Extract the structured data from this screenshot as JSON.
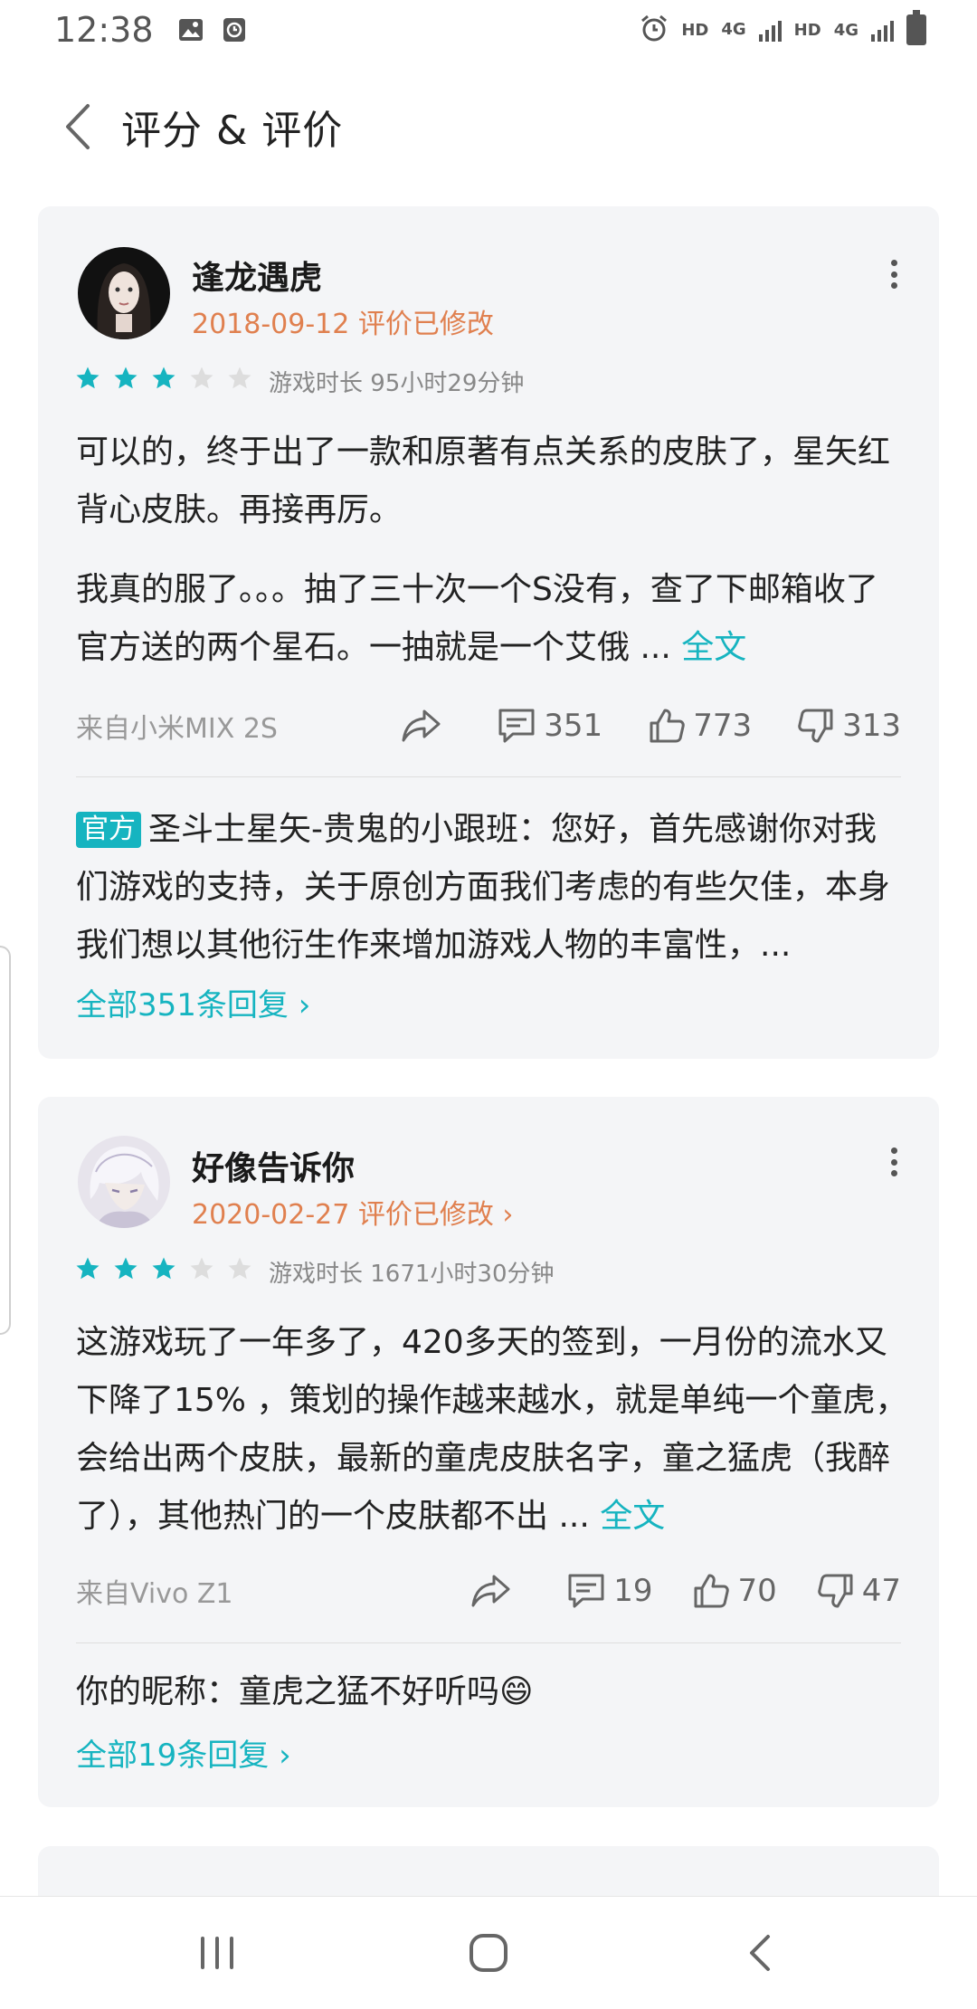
{
  "status_bar": {
    "time": "12:38",
    "indicators": [
      "HD",
      "4G",
      "HD",
      "4G"
    ],
    "icons": [
      "image-icon",
      "clock-app-icon",
      "alarm-icon",
      "signal-icon",
      "battery-icon"
    ]
  },
  "header": {
    "title": "评分 & 评价",
    "back_icon": "chevron-left-icon"
  },
  "reviews": [
    {
      "username": "逢龙遇虎",
      "date": "2018-09-12 评价已修改",
      "rating": 3,
      "max_rating": 5,
      "playtime": "游戏时长 95小时29分钟",
      "paragraphs": [
        "可以的，终于出了一款和原著有点关系的皮肤了，星矢红背心皮肤。再接再厉。",
        "我真的服了。。。抽了三十次一个S没有，查了下邮箱收了官方送的两个星石。一抽就是一个艾俄 ..."
      ],
      "full_text_label": "全文",
      "device": "来自小米MIX 2S",
      "comments": "351",
      "likes": "773",
      "dislikes": "313",
      "reply": {
        "badge": "官方",
        "text": "圣斗士星矢-贵鬼的小跟班：您好，首先感谢你对我们游戏的支持，关于原创方面我们考虑的有些欠佳，本身我们想以其他衍生作来增加游戏人物的丰富性，..."
      },
      "all_replies": "全部351条回复 ›"
    },
    {
      "username": "好像告诉你",
      "date": "2020-02-27 评价已修改 ›",
      "rating": 3,
      "max_rating": 5,
      "playtime": "游戏时长 1671小时30分钟",
      "paragraphs": [
        "这游戏玩了一年多了，420多天的签到，一月份的流水又下降了15% ，策划的操作越来越水，就是单纯一个童虎，会给出两个皮肤，最新的童虎皮肤名字，童之猛虎（我醉了），其他热门的一个皮肤都不出 ..."
      ],
      "full_text_label": "全文",
      "device": "来自Vivo Z1",
      "comments": "19",
      "likes": "70",
      "dislikes": "47",
      "reply": {
        "badge": "",
        "text": "你的昵称：童虎之猛不好听吗😄"
      },
      "all_replies": "全部19条回复 ›"
    }
  ],
  "colors": {
    "accent": "#16b4c0",
    "date": "#e0804f",
    "card_bg": "#f4f5f7",
    "star_empty": "#dddddd"
  },
  "nav_bar": {
    "icons": [
      "recent-apps-icon",
      "home-icon",
      "back-icon"
    ]
  }
}
